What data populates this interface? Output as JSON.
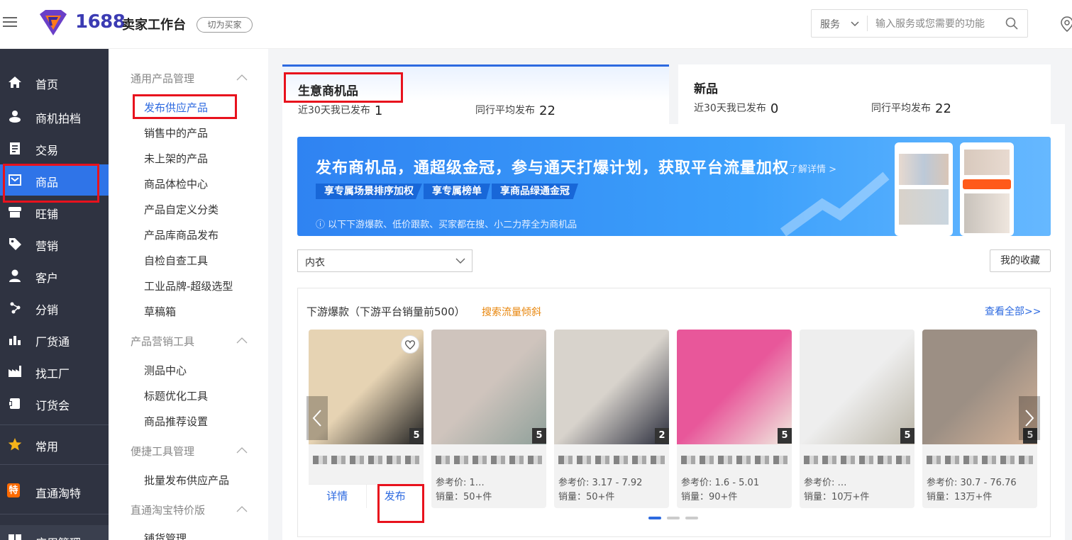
{
  "header": {
    "brand_number": "1688",
    "brand_text": "卖家工作台",
    "switch_label": "切为买家",
    "search_category": "服务",
    "search_placeholder": "输入服务或您需要的功能"
  },
  "sidebar": {
    "items": [
      {
        "label": "首页",
        "icon": "home-icon"
      },
      {
        "label": "商机拍档",
        "icon": "partner-icon"
      },
      {
        "label": "交易",
        "icon": "clipboard-icon"
      },
      {
        "label": "商品",
        "icon": "product-icon"
      },
      {
        "label": "旺铺",
        "icon": "store-icon"
      },
      {
        "label": "营销",
        "icon": "tag-icon"
      },
      {
        "label": "客户",
        "icon": "user-icon"
      },
      {
        "label": "分销",
        "icon": "distribution-icon"
      },
      {
        "label": "厂货通",
        "icon": "chart-icon"
      },
      {
        "label": "找工厂",
        "icon": "factory-icon"
      },
      {
        "label": "订货会",
        "icon": "order-icon"
      }
    ],
    "common": "常用",
    "taobao": "直通淘特",
    "taobao_badge": "特",
    "bottom": "应用管理",
    "active_index": 3,
    "accent": "#2f74e8",
    "bg": "#2f3341"
  },
  "submenu": {
    "groups": [
      {
        "title": "通用产品管理",
        "items": [
          "发布供应产品",
          "销售中的产品",
          "未上架的产品",
          "商品体检中心",
          "产品自定义分类",
          "产品库商品发布",
          "自检自查工具",
          "工业品牌-超级选型",
          "草稿箱"
        ]
      },
      {
        "title": "产品营销工具",
        "items": [
          "测品中心",
          "标题优化工具",
          "商品推荐设置"
        ]
      },
      {
        "title": "便捷工具管理",
        "items": [
          "批量发布供应产品"
        ]
      },
      {
        "title": "直通淘宝特价版",
        "items": [
          "铺货管理"
        ]
      }
    ],
    "active_item": "发布供应产品"
  },
  "tabs": [
    {
      "title": "生意商机品",
      "stat1_label": "近30天我已发布",
      "stat1_value": "1",
      "stat2_label": "同行平均发布",
      "stat2_value": "22"
    },
    {
      "title": "新品",
      "stat1_label": "近30天我已发布",
      "stat1_value": "0",
      "stat2_label": "同行平均发布",
      "stat2_value": "22"
    }
  ],
  "banner": {
    "title": "发布商机品，通超级金冠，参与通天打爆计划，获取平台流量加权",
    "link": "了解详情 >",
    "tags": [
      "享专属场景排序加权",
      "享专属榜单",
      "享商品绿通金冠"
    ],
    "note": "ⓘ 以下下游爆款、低价跟款、买家都在搜、小二力荐全为商机品"
  },
  "filter": {
    "category": "内衣",
    "favorites": "我的收藏"
  },
  "panel": {
    "title": "下游爆款（下游平台销量前500）",
    "tag": "搜索流量倾斜",
    "view_all": "查看全部>>",
    "detail_label": "详情",
    "publish_label": "发布",
    "cards": [
      {
        "count": "5",
        "price": "",
        "sales": "",
        "colors": [
          "#e6d3b3",
          "#222222"
        ]
      },
      {
        "count": "5",
        "price": "参考价: 1…",
        "sales": "销量：50+件",
        "colors": [
          "#cfc4bd",
          "#8fa09a"
        ]
      },
      {
        "count": "2",
        "price": "参考价: 3.17 - 7.92",
        "sales": "销量：50+件",
        "colors": [
          "#d8d3cc",
          "#2a2d3c"
        ]
      },
      {
        "count": "5",
        "price": "参考价: 1.6 - 5.01",
        "sales": "销量：90+件",
        "colors": [
          "#e8579a",
          "#f0ece0"
        ]
      },
      {
        "count": "5",
        "price": "参考价: …",
        "sales": "销量：10万+件",
        "colors": [
          "#eeeeee",
          "#b9b4a6"
        ]
      },
      {
        "count": "5",
        "price": "参考价: 30.7 - 76.76",
        "sales": "销量：13万+件",
        "colors": [
          "#9c8f84",
          "#d7b59a"
        ]
      }
    ]
  }
}
